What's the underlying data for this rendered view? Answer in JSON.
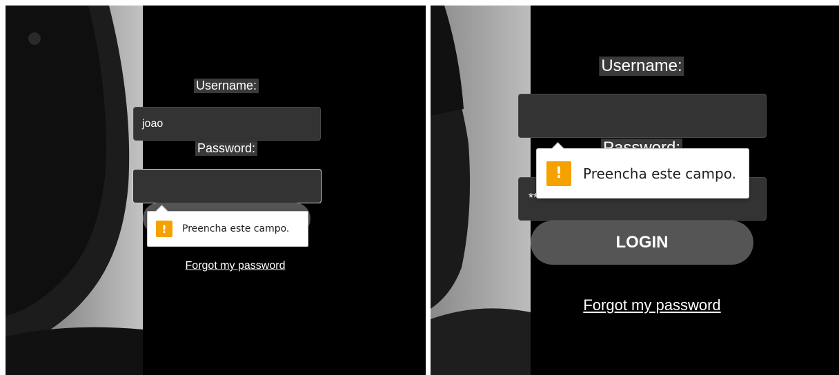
{
  "screens": [
    {
      "username_label": "Username:",
      "username_value": "joao",
      "password_label": "Password:",
      "password_value": "",
      "login_label": "",
      "forgot_label": "Forgot my password",
      "tooltip": {
        "icon": "!",
        "text": "Preencha este campo."
      }
    },
    {
      "username_label": "Username:",
      "username_value": "",
      "password_label": "Password:",
      "password_value": "****",
      "login_label": "LOGIN",
      "forgot_label": "Forgot my password",
      "tooltip": {
        "icon": "!",
        "text": "Preencha este campo."
      }
    }
  ],
  "colors": {
    "panel": "#000000",
    "field": "#333333",
    "button": "#555555",
    "warning": "#f5a100"
  },
  "icons": {
    "warning": "warning-icon"
  }
}
